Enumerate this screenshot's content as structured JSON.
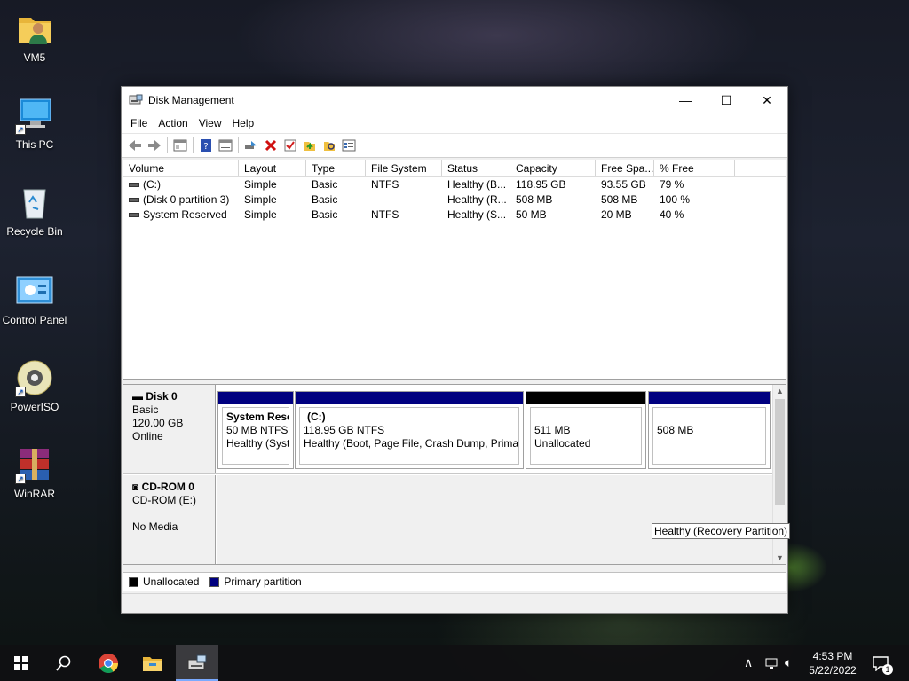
{
  "desktop": {
    "icons": [
      {
        "label": "VM5",
        "icon": "folder-user-icon"
      },
      {
        "label": "This PC",
        "icon": "computer-icon"
      },
      {
        "label": "Recycle Bin",
        "icon": "recycle-bin-icon"
      },
      {
        "label": "Control Panel",
        "icon": "control-panel-icon"
      },
      {
        "label": "PowerISO",
        "icon": "poweriso-icon"
      },
      {
        "label": "WinRAR",
        "icon": "winrar-icon"
      }
    ]
  },
  "window": {
    "title": "Disk Management",
    "controls": {
      "minimize": "—",
      "maximize": "☐",
      "close": "✕"
    },
    "menu": [
      "File",
      "Action",
      "View",
      "Help"
    ],
    "toolbar_icons": [
      "back-icon",
      "forward-icon",
      "properties-icon",
      "help-icon",
      "console-icon",
      "connect-icon",
      "delete-icon",
      "check-icon",
      "import-icon",
      "search-icon",
      "list-icon"
    ]
  },
  "volume_list": {
    "columns": [
      "Volume",
      "Layout",
      "Type",
      "File System",
      "Status",
      "Capacity",
      "Free Spa...",
      "% Free"
    ],
    "rows": [
      {
        "volume": "(C:)",
        "layout": "Simple",
        "type": "Basic",
        "file_system": "NTFS",
        "status": "Healthy (B...",
        "capacity": "118.95 GB",
        "free": "93.55 GB",
        "pct": "79 %"
      },
      {
        "volume": "(Disk 0 partition 3)",
        "layout": "Simple",
        "type": "Basic",
        "file_system": "",
        "status": "Healthy (R...",
        "capacity": "508 MB",
        "free": "508 MB",
        "pct": "100 %"
      },
      {
        "volume": "System Reserved",
        "layout": "Simple",
        "type": "Basic",
        "file_system": "NTFS",
        "status": "Healthy (S...",
        "capacity": "50 MB",
        "free": "20 MB",
        "pct": "40 %"
      }
    ]
  },
  "disks": [
    {
      "name": "Disk 0",
      "type": "Basic",
      "size": "120.00 GB",
      "state": "Online",
      "partitions": [
        {
          "title": "System Rese",
          "line1": "50 MB NTFS",
          "line2": "Healthy (Syste",
          "bar": "primary"
        },
        {
          "title": "(C:)",
          "line1": "118.95 GB NTFS",
          "line2": "Healthy (Boot, Page File, Crash Dump, Primary",
          "bar": "primary"
        },
        {
          "title": "",
          "line1": "511 MB",
          "line2": "Unallocated",
          "bar": "unallocated"
        },
        {
          "title": "",
          "line1": "508 MB",
          "line2": "",
          "bar": "primary"
        }
      ]
    },
    {
      "name": "CD-ROM 0",
      "type": "CD-ROM (E:)",
      "size": "",
      "state": "No Media"
    }
  ],
  "tooltip": "Healthy (Recovery Partition)",
  "legend": [
    {
      "label": "Unallocated",
      "color": "#000000"
    },
    {
      "label": "Primary partition",
      "color": "#000080"
    }
  ],
  "taskbar": {
    "items": [
      "start-icon",
      "search-icon",
      "chrome-icon",
      "file-explorer-icon",
      "disk-management-icon"
    ],
    "time": "4:53 PM",
    "date": "5/22/2022",
    "notification_count": "1"
  }
}
